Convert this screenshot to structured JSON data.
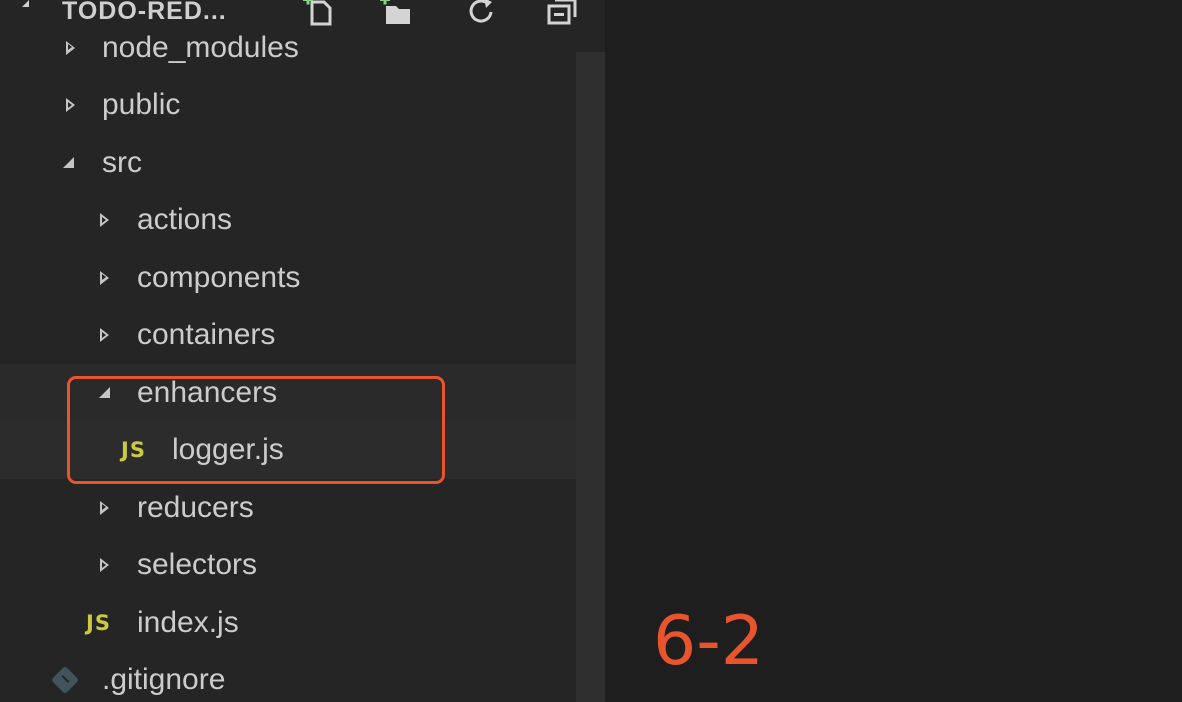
{
  "explorer": {
    "section_title": "TODO-RED...",
    "header_icons": [
      "new-file-icon",
      "new-folder-icon",
      "refresh-icon",
      "collapse-all-icon"
    ]
  },
  "tree": {
    "items": [
      {
        "label": "node_modules",
        "kind": "folder",
        "expanded": false,
        "depth": 0
      },
      {
        "label": "public",
        "kind": "folder",
        "expanded": false,
        "depth": 0
      },
      {
        "label": "src",
        "kind": "folder",
        "expanded": true,
        "depth": 0
      },
      {
        "label": "actions",
        "kind": "folder",
        "expanded": false,
        "depth": 1
      },
      {
        "label": "components",
        "kind": "folder",
        "expanded": false,
        "depth": 1
      },
      {
        "label": "containers",
        "kind": "folder",
        "expanded": false,
        "depth": 1
      },
      {
        "label": "enhancers",
        "kind": "folder",
        "expanded": true,
        "depth": 1
      },
      {
        "label": "logger.js",
        "kind": "file",
        "icon_text": "JS",
        "depth": 2
      },
      {
        "label": "reducers",
        "kind": "folder",
        "expanded": false,
        "depth": 1
      },
      {
        "label": "selectors",
        "kind": "folder",
        "expanded": false,
        "depth": 1
      },
      {
        "label": "index.js",
        "kind": "file",
        "icon_text": "JS",
        "depth": 1
      },
      {
        "label": ".gitignore",
        "kind": "file",
        "icon": "git-icon",
        "depth": 0
      }
    ]
  },
  "overlay": {
    "clip_number": "6-2"
  },
  "colors": {
    "sidebar_bg": "#252526",
    "editor_bg": "#1e1e1e",
    "highlight": "#e8552d",
    "js_icon": "#cbcb41"
  }
}
